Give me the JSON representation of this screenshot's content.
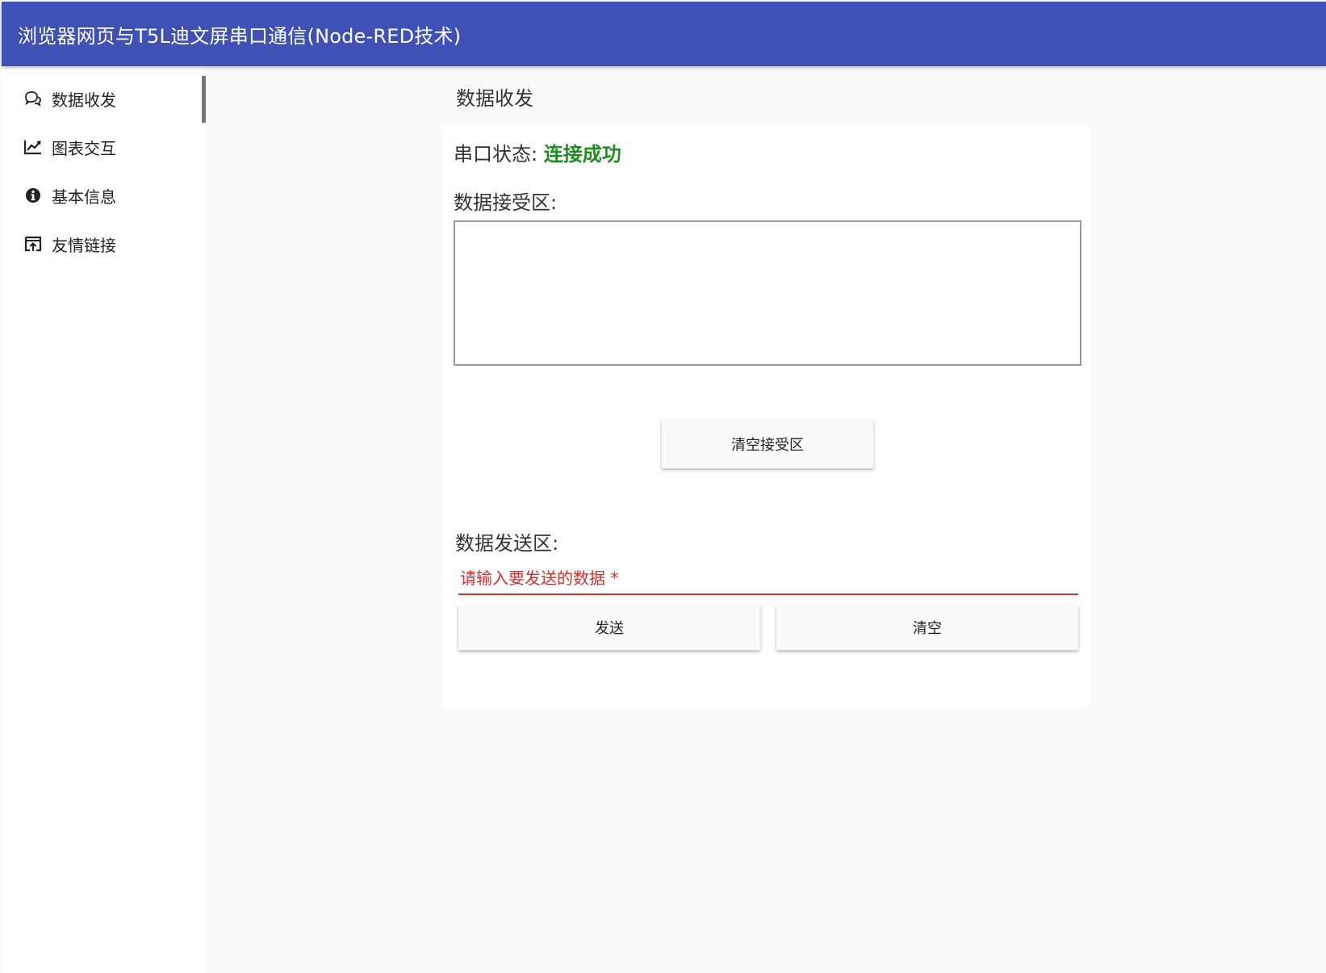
{
  "header": {
    "title": "浏览器网页与T5L迪文屏串口通信(Node-RED技术)",
    "color": "#3f51b5"
  },
  "sidebar": {
    "items": [
      {
        "label": "数据收发",
        "icon": "chat-bubbles-icon",
        "active": true
      },
      {
        "label": "图表交互",
        "icon": "line-chart-icon",
        "active": false
      },
      {
        "label": "基本信息",
        "icon": "info-icon",
        "active": false
      },
      {
        "label": "友情链接",
        "icon": "open-in-new-icon",
        "active": false
      }
    ]
  },
  "main": {
    "heading": "数据收发",
    "status": {
      "label": "串口状态:",
      "value": "连接成功",
      "value_color": "#228b22"
    },
    "receive": {
      "label": "数据接受区:",
      "value": "",
      "clear_button": "清空接受区"
    },
    "send": {
      "label": "数据发送区:",
      "placeholder": "请输入要发送的数据 *",
      "value": "",
      "send_button": "发送",
      "clear_button": "清空",
      "error_color": "#d32f2f"
    }
  }
}
